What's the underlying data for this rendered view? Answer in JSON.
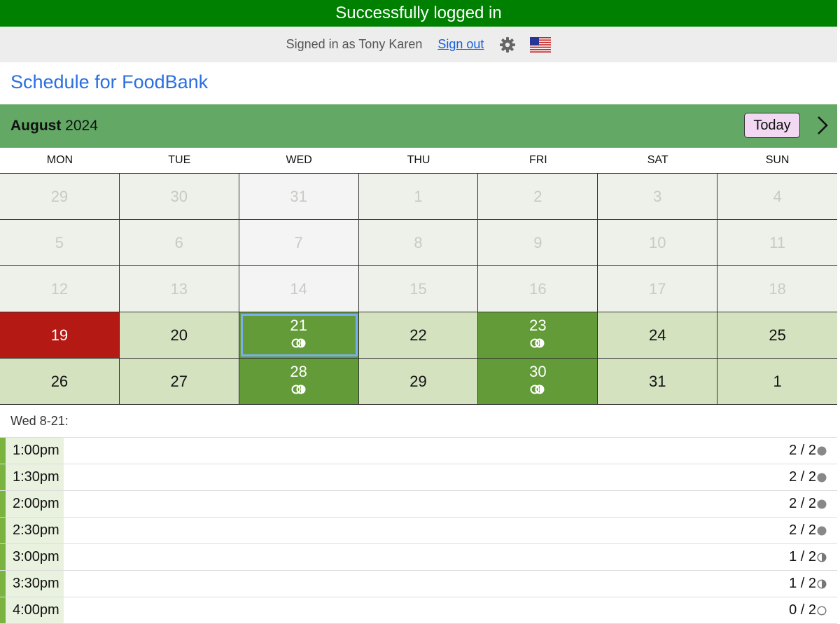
{
  "banner": {
    "message": "Successfully logged in"
  },
  "userbar": {
    "signed_in_text": "Signed in as Tony Karen",
    "sign_out_label": "Sign out"
  },
  "page": {
    "title": "Schedule for FoodBank"
  },
  "calendar": {
    "month": "August",
    "year": "2024",
    "today_label": "Today",
    "days_of_week": [
      "MON",
      "TUE",
      "WED",
      "THU",
      "FRI",
      "SAT",
      "SUN"
    ],
    "weeks": [
      [
        {
          "day": "29",
          "state": "past"
        },
        {
          "day": "30",
          "state": "past"
        },
        {
          "day": "31",
          "state": "past"
        },
        {
          "day": "1",
          "state": "past"
        },
        {
          "day": "2",
          "state": "past"
        },
        {
          "day": "3",
          "state": "past"
        },
        {
          "day": "4",
          "state": "past"
        }
      ],
      [
        {
          "day": "5",
          "state": "past"
        },
        {
          "day": "6",
          "state": "past"
        },
        {
          "day": "7",
          "state": "past"
        },
        {
          "day": "8",
          "state": "past"
        },
        {
          "day": "9",
          "state": "past"
        },
        {
          "day": "10",
          "state": "past"
        },
        {
          "day": "11",
          "state": "past"
        }
      ],
      [
        {
          "day": "12",
          "state": "past"
        },
        {
          "day": "13",
          "state": "past"
        },
        {
          "day": "14",
          "state": "past"
        },
        {
          "day": "15",
          "state": "past"
        },
        {
          "day": "16",
          "state": "past"
        },
        {
          "day": "17",
          "state": "past"
        },
        {
          "day": "18",
          "state": "past"
        }
      ],
      [
        {
          "day": "19",
          "state": "today"
        },
        {
          "day": "20",
          "state": "available"
        },
        {
          "day": "21",
          "state": "shift",
          "indicator": true,
          "selected": true
        },
        {
          "day": "22",
          "state": "available"
        },
        {
          "day": "23",
          "state": "shift",
          "indicator": true
        },
        {
          "day": "24",
          "state": "available"
        },
        {
          "day": "25",
          "state": "available"
        }
      ],
      [
        {
          "day": "26",
          "state": "available"
        },
        {
          "day": "27",
          "state": "available"
        },
        {
          "day": "28",
          "state": "shift",
          "indicator": true
        },
        {
          "day": "29",
          "state": "available"
        },
        {
          "day": "30",
          "state": "shift",
          "indicator": true
        },
        {
          "day": "31",
          "state": "available"
        },
        {
          "day": "1",
          "state": "available"
        }
      ]
    ]
  },
  "selected_day": {
    "label": "Wed 8-21:",
    "slots": [
      {
        "time": "1:00pm",
        "filled": "2 / 2",
        "status": "full"
      },
      {
        "time": "1:30pm",
        "filled": "2 / 2",
        "status": "full"
      },
      {
        "time": "2:00pm",
        "filled": "2 / 2",
        "status": "full"
      },
      {
        "time": "2:30pm",
        "filled": "2 / 2",
        "status": "full"
      },
      {
        "time": "3:00pm",
        "filled": "1 / 2",
        "status": "half"
      },
      {
        "time": "3:30pm",
        "filled": "1 / 2",
        "status": "half"
      },
      {
        "time": "4:00pm",
        "filled": "0 / 2",
        "status": "empty"
      }
    ]
  },
  "colors": {
    "banner": "#008000",
    "month_bar": "#63a865",
    "today_cell": "#b51913",
    "shift_cell": "#639b38",
    "available_cell": "#d5e2c0",
    "selection_outline": "#7aaef0",
    "link": "#1a5fd6"
  },
  "icons": {
    "settings": "gear-icon",
    "language": "us-flag-icon",
    "next_month": "chevron-right-icon",
    "day_indicator": "shift-toggle-icon"
  }
}
